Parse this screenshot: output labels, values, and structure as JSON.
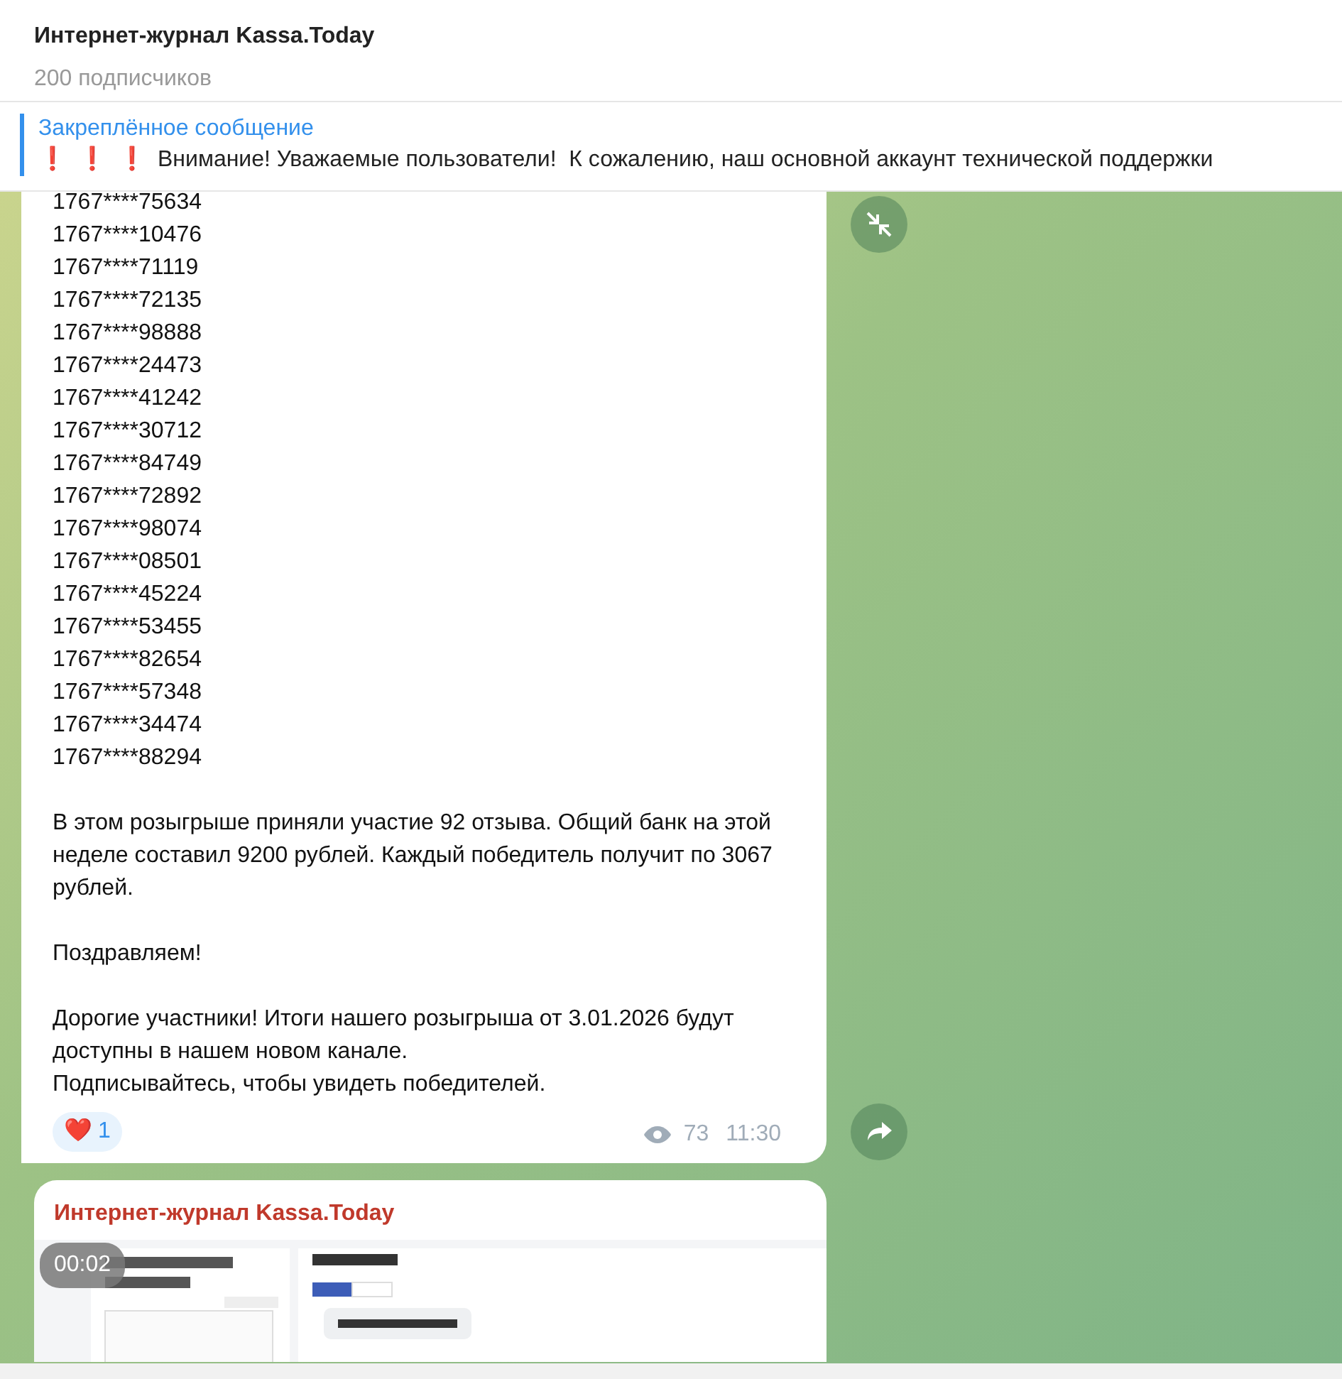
{
  "header": {
    "title": "Интернет-журнал Kassa.Today",
    "subtitle": "200 подписчиков"
  },
  "pinned": {
    "label": "Закреплённое сообщение",
    "marks": [
      "❗",
      "❗",
      "❗"
    ],
    "text": "Внимание! Уважаемые пользователи!  К сожалению, наш основной аккаунт технической поддержки"
  },
  "messages": [
    {
      "kind": "text",
      "lines": [
        "1767****75634",
        "1767****10476",
        "1767****71119",
        "1767****72135",
        "1767****98888",
        "1767****24473",
        "1767****41242",
        "1767****30712",
        "1767****84749",
        "1767****72892",
        "1767****98074",
        "1767****08501",
        "1767****45224",
        "1767****53455",
        "1767****82654",
        "1767****57348",
        "1767****34474",
        "1767****88294"
      ],
      "paragraphs": [
        "В этом розыгрыше приняли участие 92 отзыва. Общий банк на этой неделе составил 9200 рублей. Каждый победитель получит по 3067 рублей.",
        "Поздравляем!",
        "Дорогие участники! Итоги нашего розыгрыша от 3.01.2026 будут доступны в нашем новом канале.\nПодписывайтесь, чтобы увидеть победителей."
      ],
      "reaction": {
        "emoji": "❤️",
        "count": "1"
      },
      "views": "73",
      "time": "11:30"
    },
    {
      "kind": "video",
      "author": "Интернет-журнал Kassa.Today",
      "duration": "00:02"
    }
  ]
}
